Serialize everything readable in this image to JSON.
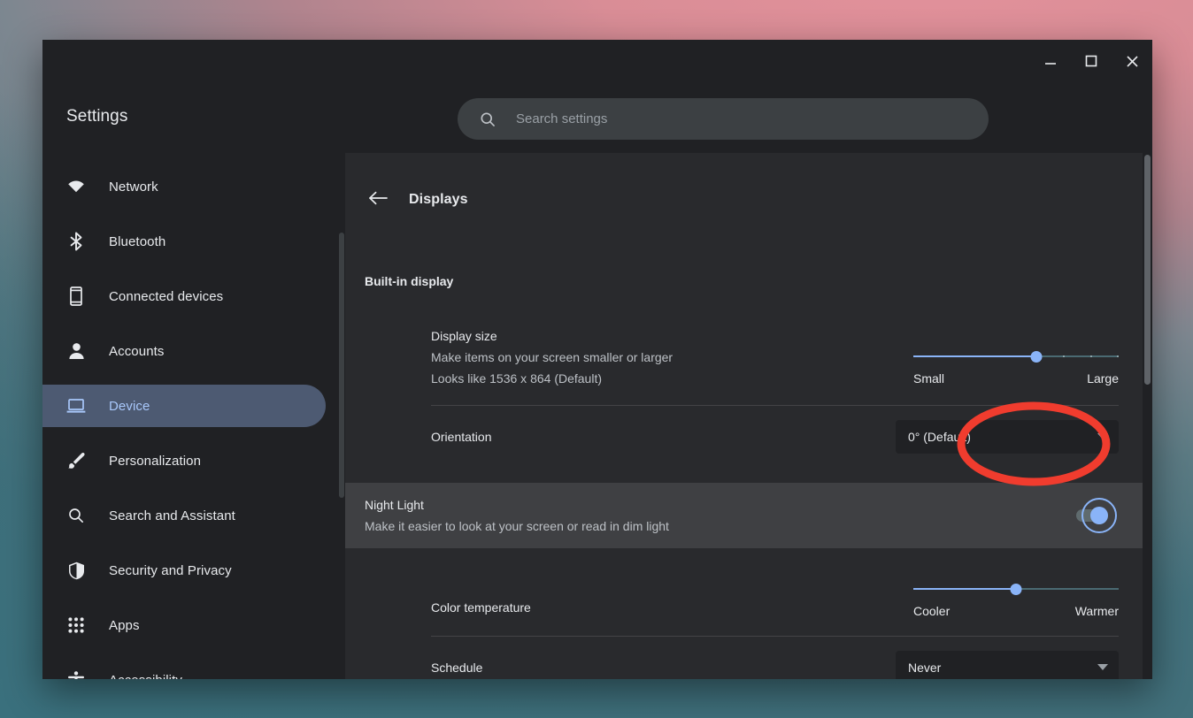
{
  "window": {
    "app_title": "Settings",
    "controls": [
      {
        "name": "minimize-button",
        "glyph": "minimize"
      },
      {
        "name": "maximize-button",
        "glyph": "maximize"
      },
      {
        "name": "close-button",
        "glyph": "close"
      }
    ]
  },
  "search": {
    "placeholder": "Search settings",
    "value": "",
    "icon": "search-icon"
  },
  "sidebar": {
    "items": [
      {
        "label": "Network",
        "icon": "wifi-icon",
        "selected": false
      },
      {
        "label": "Bluetooth",
        "icon": "bluetooth-icon",
        "selected": false
      },
      {
        "label": "Connected devices",
        "icon": "phone-icon",
        "selected": false
      },
      {
        "label": "Accounts",
        "icon": "person-icon",
        "selected": false
      },
      {
        "label": "Device",
        "icon": "laptop-icon",
        "selected": true
      },
      {
        "label": "Personalization",
        "icon": "brush-icon",
        "selected": false
      },
      {
        "label": "Search and Assistant",
        "icon": "search-icon",
        "selected": false
      },
      {
        "label": "Security and Privacy",
        "icon": "shield-icon",
        "selected": false
      },
      {
        "label": "Apps",
        "icon": "grid-icon",
        "selected": false
      },
      {
        "label": "Accessibility",
        "icon": "accessibility-icon",
        "selected": false
      }
    ]
  },
  "page": {
    "title": "Displays",
    "back_icon": "arrow-left-icon",
    "section_heading": "Built-in display",
    "display_size": {
      "title": "Display size",
      "subtitle": "Make items on your screen smaller or larger",
      "detail": "Looks like 1536 x 864 (Default)",
      "slider": {
        "min_label": "Small",
        "max_label": "Large",
        "percent": 60
      }
    },
    "orientation": {
      "label": "Orientation",
      "value": "0° (Default)",
      "caret_icon": "chevron-down-icon"
    },
    "night_light": {
      "title": "Night Light",
      "subtitle": "Make it easier to look at your screen or read in dim light",
      "toggle_state": "on",
      "toggle_icon": "toggle-switch-icon"
    },
    "color_temperature": {
      "label": "Color temperature",
      "slider": {
        "min_label": "Cooler",
        "max_label": "Warmer",
        "percent": 50
      }
    },
    "schedule": {
      "label": "Schedule",
      "value": "Never",
      "caret_icon": "chevron-down-icon"
    }
  },
  "annotation": {
    "shape": "ellipse",
    "color": "#f03c2e",
    "target": "night-light-toggle"
  },
  "colors": {
    "accent": "#8ab4f8",
    "window_bg": "#202124",
    "content_bg": "#292a2d",
    "selected_nav_bg": "#4d5a72",
    "highlight_row_bg": "#3f4043"
  }
}
